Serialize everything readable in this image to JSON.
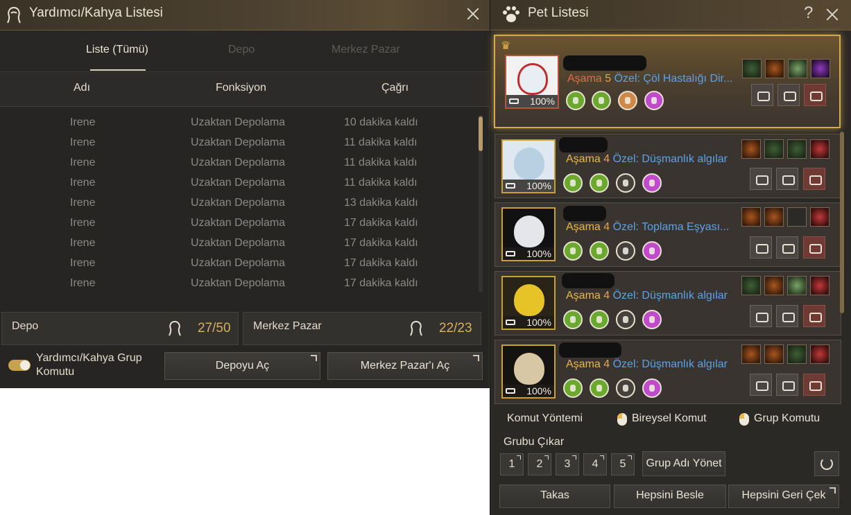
{
  "left": {
    "title": "Yardımcı/Kahya Listesi",
    "tabs": [
      "Liste (Tümü)",
      "Depo",
      "Merkez Pazar"
    ],
    "columns": [
      "Adı",
      "Fonksiyon",
      "Çağrı"
    ],
    "rows": [
      {
        "name": "Irene",
        "function": "Uzaktan Depolama",
        "call": "10 dakika kaldı"
      },
      {
        "name": "Irene",
        "function": "Uzaktan Depolama",
        "call": "11 dakika kaldı"
      },
      {
        "name": "Irene",
        "function": "Uzaktan Depolama",
        "call": "11 dakika kaldı"
      },
      {
        "name": "Irene",
        "function": "Uzaktan Depolama",
        "call": "11 dakika kaldı"
      },
      {
        "name": "Irene",
        "function": "Uzaktan Depolama",
        "call": "13 dakika kaldı"
      },
      {
        "name": "Irene",
        "function": "Uzaktan Depolama",
        "call": "17 dakika kaldı"
      },
      {
        "name": "Irene",
        "function": "Uzaktan Depolama",
        "call": "17 dakika kaldı"
      },
      {
        "name": "Irene",
        "function": "Uzaktan Depolama",
        "call": "17 dakika kaldı"
      },
      {
        "name": "Irene",
        "function": "Uzaktan Depolama",
        "call": "17 dakika kaldı"
      }
    ],
    "depo": {
      "label": "Depo",
      "count": "27",
      "max": "50"
    },
    "pazar": {
      "label": "Merkez Pazar",
      "count": "22",
      "max": "23"
    },
    "toggle_label": "Yardımcı/Kahya Grup Komutu",
    "open_depo": "Depoyu Aç",
    "open_pazar": "Merkez Pazar'ı Aç"
  },
  "right": {
    "title": "Pet Listesi",
    "help": "?",
    "pets": [
      {
        "stage_label": "Aşama",
        "stage": "5",
        "special": "Özel: Çöl Hastalığı Dir...",
        "hunger": "100%"
      },
      {
        "stage_label": "Aşama",
        "stage": "4",
        "special": "Özel: Düşmanlık algılar",
        "hunger": "100%"
      },
      {
        "stage_label": "Aşama",
        "stage": "4",
        "special": "Özel: Toplama Eşyası...",
        "hunger": "100%"
      },
      {
        "stage_label": "Aşama",
        "stage": "4",
        "special": "Özel: Düşmanlık algılar",
        "hunger": "100%"
      },
      {
        "stage_label": "Aşama",
        "stage": "4",
        "special": "Özel: Düşmanlık algılar",
        "hunger": "100%"
      }
    ],
    "command_method": "Komut Yöntemi",
    "individual": "Bireysel Komut",
    "group": "Grup Komutu",
    "remove_group": "Grubu Çıkar",
    "group_numbers": [
      "1",
      "2",
      "3",
      "4",
      "5"
    ],
    "manage_group": "Grup Adı Yönet",
    "trade": "Takas",
    "feed_all": "Hepsini Besle",
    "recall_all": "Hepsini Geri Çek"
  },
  "colors": {
    "accent_gold": "#d8b15a",
    "special_blue": "#5aa3e8",
    "stage_orange": "#e8b84a"
  }
}
